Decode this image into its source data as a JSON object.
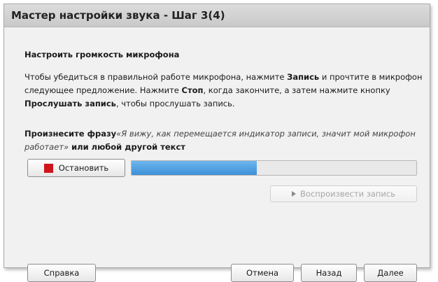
{
  "window": {
    "title": "Мастер настройки звука - Шаг 3(4)"
  },
  "section": {
    "title": "Настроить громкость микрофона"
  },
  "instructions": {
    "part1": "Чтобы убедиться в правильной работе микрофона, нажмите ",
    "record_label": "Запись",
    "part2": " и прочтите в микрофон следующее предложение. Нажмите ",
    "stop_label": "Стоп",
    "part3": ", когда закончите, а затем нажмите кнопку ",
    "listen_label": "Прослушать запись",
    "part4": ", чтобы прослушать запись."
  },
  "phrase": {
    "lead": "Произнесите фразу",
    "quote": "«Я вижу, как перемещается индикатор записи, значит мой микрофон работает»",
    "tail": " или любой другой текст"
  },
  "recording": {
    "stop_button_label": "Остановить",
    "stop_icon": "stop-square-icon",
    "level_fraction": 0.44,
    "level_color": "#4a9ee3",
    "play_button_label": "Воспроизвести запись",
    "play_icon": "play-icon",
    "play_enabled": false
  },
  "footer": {
    "help_label": "Справка",
    "cancel_label": "Отмена",
    "back_label": "Назад",
    "next_label": "Далее"
  }
}
